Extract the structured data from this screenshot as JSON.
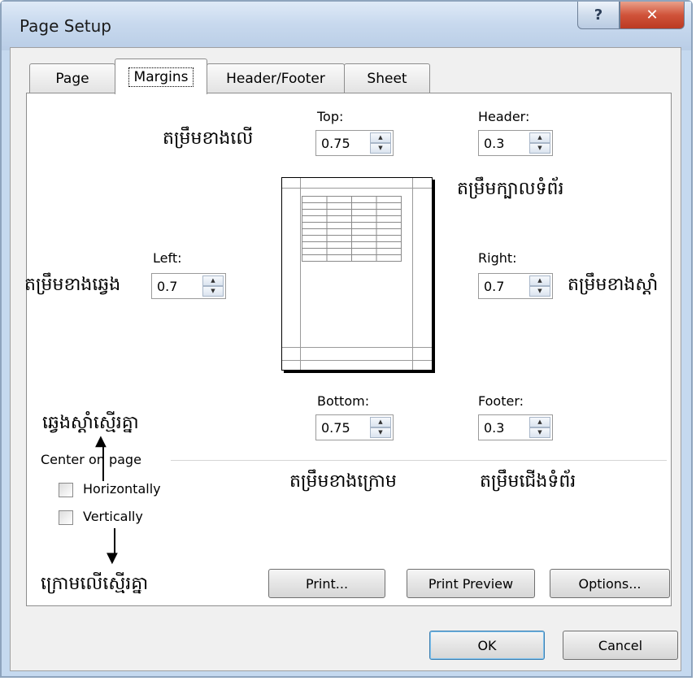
{
  "window": {
    "title": "Page Setup",
    "help_glyph": "?",
    "close_glyph": "✕"
  },
  "tabs": [
    {
      "label": "Page"
    },
    {
      "label": "Margins"
    },
    {
      "label": "Header/Footer"
    },
    {
      "label": "Sheet"
    }
  ],
  "margins": {
    "top": {
      "label": "Top:",
      "value": "0.75",
      "note": "តម្រឹមខាងលើ"
    },
    "header": {
      "label": "Header:",
      "value": "0.3",
      "note": "តម្រឹមក្បាលទំព័រ"
    },
    "left": {
      "label": "Left:",
      "value": "0.7",
      "note": "តម្រឹមខាងឆ្វេង"
    },
    "right": {
      "label": "Right:",
      "value": "0.7",
      "note": "តម្រឹមខាងស្តាំ"
    },
    "bottom": {
      "label": "Bottom:",
      "value": "0.75",
      "note": "តម្រឹមខាងក្រោម"
    },
    "footer": {
      "label": "Footer:",
      "value": "0.3",
      "note": "តម្រឹមជើងទំព័រ"
    }
  },
  "center_on_page": {
    "label": "Center on page",
    "horizontally": "Horizontally",
    "vertically": "Vertically",
    "note_horizontal": "ឆ្វេងស្តាំស្មើរគ្នា",
    "note_vertical": "ក្រោមលើស្មើរគ្នា"
  },
  "buttons": {
    "print": "Print...",
    "print_preview": "Print Preview",
    "options": "Options...",
    "ok": "OK",
    "cancel": "Cancel"
  }
}
